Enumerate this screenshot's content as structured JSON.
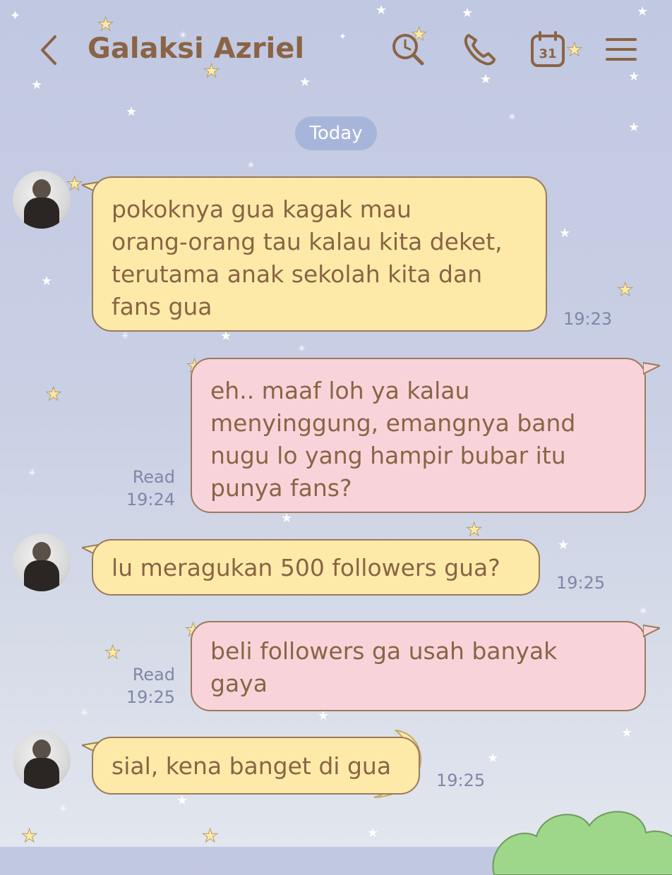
{
  "header": {
    "back_icon": "chevron-left-icon",
    "title": "Galaksi Azriel",
    "icons": [
      "search-icon",
      "phone-icon",
      "calendar-icon",
      "menu-icon"
    ],
    "calendar_day": "31"
  },
  "date_divider": "Today",
  "colors": {
    "incoming_bubble": "#fdeaa8",
    "outgoing_bubble": "#f8d4da",
    "bubble_text": "#8a6445",
    "meta_text": "#7f87a8",
    "date_pill": "#a8b5da"
  },
  "messages": [
    {
      "direction": "incoming",
      "text": "pokoknya gua kagak mau\norang-orang tau kalau kita deket,\nterutama anak sekolah kita dan\nfans gua",
      "time": "19:23"
    },
    {
      "direction": "outgoing",
      "text": "eh.. maaf loh ya kalau\nmenyinggung, emangnya band\nnugu lo yang hampir bubar itu\npunya fans?",
      "read": "Read",
      "time": "19:24"
    },
    {
      "direction": "incoming",
      "text": "lu meragukan 500 followers gua?",
      "time": "19:25"
    },
    {
      "direction": "outgoing",
      "text": "beli followers ga usah banyak\ngaya",
      "read": "Read",
      "time": "19:25"
    },
    {
      "direction": "incoming",
      "text": "sial, kena banget di gua",
      "time": "19:25"
    }
  ]
}
